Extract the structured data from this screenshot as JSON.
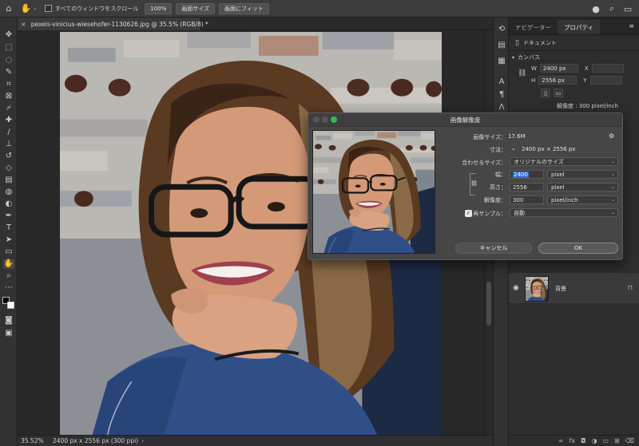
{
  "options_bar": {
    "scroll_all_label": "すべてのウィンドウをスクロール",
    "btn_100": "100%",
    "btn_fit_screen": "画面サイズ",
    "btn_fill_screen": "画面にフィット"
  },
  "document": {
    "tab_title": "pexels-vinicius-wiesehofer-1130626.jpg @ 35.5% (RGB/8) *",
    "zoom": "35.52%",
    "status_info": "2400 px x 2556 px (300 ppi)"
  },
  "right_panel": {
    "tabs": [
      "ナビゲーター",
      "プロパティ"
    ],
    "active_tab": 1,
    "doc_label": "ドキュメント",
    "canvas_header": "カンバス",
    "w_label": "W",
    "w_value": "2400 px",
    "h_label": "H",
    "h_value": "2556 px",
    "x_label": "X",
    "y_label": "Y",
    "resolution": "解像度 : 300 pixel/inch",
    "layer_name": "背景"
  },
  "dialog": {
    "title": "画像解像度",
    "image_size_label": "画像サイズ：",
    "image_size_value": "17.6M",
    "dimensions_label": "寸法：",
    "dimensions_value": "2400 px × 2556 px",
    "fit_to_label": "合わせるサイズ：",
    "fit_to_value": "オリジナルのサイズ",
    "width_label": "幅：",
    "width_value": "2400",
    "width_unit": "pixel",
    "height_label": "高さ：",
    "height_value": "2556",
    "height_unit": "pixel",
    "resolution_label": "解像度：",
    "resolution_value": "300",
    "resolution_unit": "pixel/inch",
    "resample_label": "再サンプル：",
    "resample_value": "自動",
    "cancel_label": "キャンセル",
    "ok_label": "OK"
  },
  "colors": {
    "accent_selection": "#2f6ed2",
    "traffic_red": "#4a4a4a",
    "traffic_yellow": "#4a4a4a",
    "traffic_green": "#2fbf4a"
  }
}
